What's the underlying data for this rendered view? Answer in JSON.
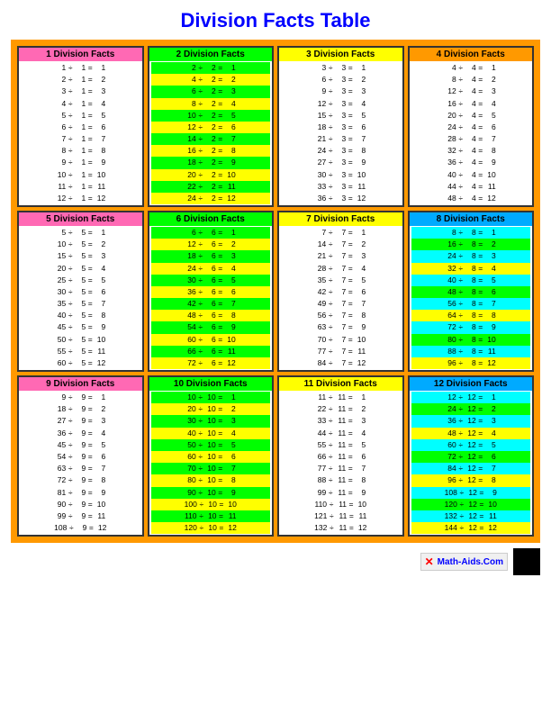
{
  "title": "Division Facts Table",
  "sections": [
    {
      "id": 1,
      "label": "1 Division Facts",
      "headerClass": "h1",
      "rows": [
        [
          1,
          1,
          1
        ],
        [
          2,
          1,
          2
        ],
        [
          3,
          1,
          3
        ],
        [
          4,
          1,
          4
        ],
        [
          5,
          1,
          5
        ],
        [
          6,
          1,
          6
        ],
        [
          7,
          1,
          7
        ],
        [
          8,
          1,
          8
        ],
        [
          9,
          1,
          9
        ],
        [
          10,
          1,
          10
        ],
        [
          11,
          1,
          11
        ],
        [
          12,
          1,
          12
        ]
      ]
    },
    {
      "id": 2,
      "label": "2 Division Facts",
      "headerClass": "h2",
      "rows": [
        [
          2,
          2,
          1
        ],
        [
          4,
          2,
          2
        ],
        [
          6,
          2,
          3
        ],
        [
          8,
          2,
          4
        ],
        [
          10,
          2,
          5
        ],
        [
          12,
          2,
          6
        ],
        [
          14,
          2,
          7
        ],
        [
          16,
          2,
          8
        ],
        [
          18,
          2,
          9
        ],
        [
          20,
          2,
          10
        ],
        [
          22,
          2,
          11
        ],
        [
          24,
          2,
          12
        ]
      ]
    },
    {
      "id": 3,
      "label": "3 Division Facts",
      "headerClass": "h3",
      "rows": [
        [
          3,
          3,
          1
        ],
        [
          6,
          3,
          2
        ],
        [
          9,
          3,
          3
        ],
        [
          12,
          3,
          4
        ],
        [
          15,
          3,
          5
        ],
        [
          18,
          3,
          6
        ],
        [
          21,
          3,
          7
        ],
        [
          24,
          3,
          8
        ],
        [
          27,
          3,
          9
        ],
        [
          30,
          3,
          10
        ],
        [
          33,
          3,
          11
        ],
        [
          36,
          3,
          12
        ]
      ]
    },
    {
      "id": 4,
      "label": "4 Division Facts",
      "headerClass": "h4",
      "rows": [
        [
          4,
          4,
          1
        ],
        [
          8,
          4,
          2
        ],
        [
          12,
          4,
          3
        ],
        [
          16,
          4,
          4
        ],
        [
          20,
          4,
          5
        ],
        [
          24,
          4,
          6
        ],
        [
          28,
          4,
          7
        ],
        [
          32,
          4,
          8
        ],
        [
          36,
          4,
          9
        ],
        [
          40,
          4,
          10
        ],
        [
          44,
          4,
          11
        ],
        [
          48,
          4,
          12
        ]
      ]
    },
    {
      "id": 5,
      "label": "5 Division Facts",
      "headerClass": "h5",
      "rows": [
        [
          5,
          5,
          1
        ],
        [
          10,
          5,
          2
        ],
        [
          15,
          5,
          3
        ],
        [
          20,
          5,
          4
        ],
        [
          25,
          5,
          5
        ],
        [
          30,
          5,
          6
        ],
        [
          35,
          5,
          7
        ],
        [
          40,
          5,
          8
        ],
        [
          45,
          5,
          9
        ],
        [
          50,
          5,
          10
        ],
        [
          55,
          5,
          11
        ],
        [
          60,
          5,
          12
        ]
      ]
    },
    {
      "id": 6,
      "label": "6 Division Facts",
      "headerClass": "h6",
      "rows": [
        [
          6,
          6,
          1
        ],
        [
          12,
          6,
          2
        ],
        [
          18,
          6,
          3
        ],
        [
          24,
          6,
          4
        ],
        [
          30,
          6,
          5
        ],
        [
          36,
          6,
          6
        ],
        [
          42,
          6,
          7
        ],
        [
          48,
          6,
          8
        ],
        [
          54,
          6,
          9
        ],
        [
          60,
          6,
          10
        ],
        [
          66,
          6,
          11
        ],
        [
          72,
          6,
          12
        ]
      ]
    },
    {
      "id": 7,
      "label": "7 Division Facts",
      "headerClass": "h7",
      "rows": [
        [
          7,
          7,
          1
        ],
        [
          14,
          7,
          2
        ],
        [
          21,
          7,
          3
        ],
        [
          28,
          7,
          4
        ],
        [
          35,
          7,
          5
        ],
        [
          42,
          7,
          6
        ],
        [
          49,
          7,
          7
        ],
        [
          56,
          7,
          8
        ],
        [
          63,
          7,
          9
        ],
        [
          70,
          7,
          10
        ],
        [
          77,
          7,
          11
        ],
        [
          84,
          7,
          12
        ]
      ]
    },
    {
      "id": 8,
      "label": "8 Division Facts",
      "headerClass": "h8",
      "rows": [
        [
          8,
          8,
          1
        ],
        [
          16,
          8,
          2
        ],
        [
          24,
          8,
          3
        ],
        [
          32,
          8,
          4
        ],
        [
          40,
          8,
          5
        ],
        [
          48,
          8,
          6
        ],
        [
          56,
          8,
          7
        ],
        [
          64,
          8,
          8
        ],
        [
          72,
          8,
          9
        ],
        [
          80,
          8,
          10
        ],
        [
          88,
          8,
          11
        ],
        [
          96,
          8,
          12
        ]
      ]
    },
    {
      "id": 9,
      "label": "9 Division Facts",
      "headerClass": "h9",
      "rows": [
        [
          9,
          9,
          1
        ],
        [
          18,
          9,
          2
        ],
        [
          27,
          9,
          3
        ],
        [
          36,
          9,
          4
        ],
        [
          45,
          9,
          5
        ],
        [
          54,
          9,
          6
        ],
        [
          63,
          9,
          7
        ],
        [
          72,
          9,
          8
        ],
        [
          81,
          9,
          9
        ],
        [
          90,
          9,
          10
        ],
        [
          99,
          9,
          11
        ],
        [
          108,
          9,
          12
        ]
      ]
    },
    {
      "id": 10,
      "label": "10 Division Facts",
      "headerClass": "h10",
      "rows": [
        [
          10,
          10,
          1
        ],
        [
          20,
          10,
          2
        ],
        [
          30,
          10,
          3
        ],
        [
          40,
          10,
          4
        ],
        [
          50,
          10,
          5
        ],
        [
          60,
          10,
          6
        ],
        [
          70,
          10,
          7
        ],
        [
          80,
          10,
          8
        ],
        [
          90,
          10,
          9
        ],
        [
          100,
          10,
          10
        ],
        [
          110,
          10,
          11
        ],
        [
          120,
          10,
          12
        ]
      ]
    },
    {
      "id": 11,
      "label": "11 Division Facts",
      "headerClass": "h11",
      "rows": [
        [
          11,
          11,
          1
        ],
        [
          22,
          11,
          2
        ],
        [
          33,
          11,
          3
        ],
        [
          44,
          11,
          4
        ],
        [
          55,
          11,
          5
        ],
        [
          66,
          11,
          6
        ],
        [
          77,
          11,
          7
        ],
        [
          88,
          11,
          8
        ],
        [
          99,
          11,
          9
        ],
        [
          110,
          11,
          10
        ],
        [
          121,
          11,
          11
        ],
        [
          132,
          11,
          12
        ]
      ]
    },
    {
      "id": 12,
      "label": "12 Division Facts",
      "headerClass": "h12",
      "rows": [
        [
          12,
          12,
          1
        ],
        [
          24,
          12,
          2
        ],
        [
          36,
          12,
          3
        ],
        [
          48,
          12,
          4
        ],
        [
          60,
          12,
          5
        ],
        [
          72,
          12,
          6
        ],
        [
          84,
          12,
          7
        ],
        [
          96,
          12,
          8
        ],
        [
          108,
          12,
          9
        ],
        [
          120,
          12,
          10
        ],
        [
          132,
          12,
          11
        ],
        [
          144,
          12,
          12
        ]
      ]
    }
  ],
  "footer": {
    "label": "Math-Aids.Com"
  }
}
